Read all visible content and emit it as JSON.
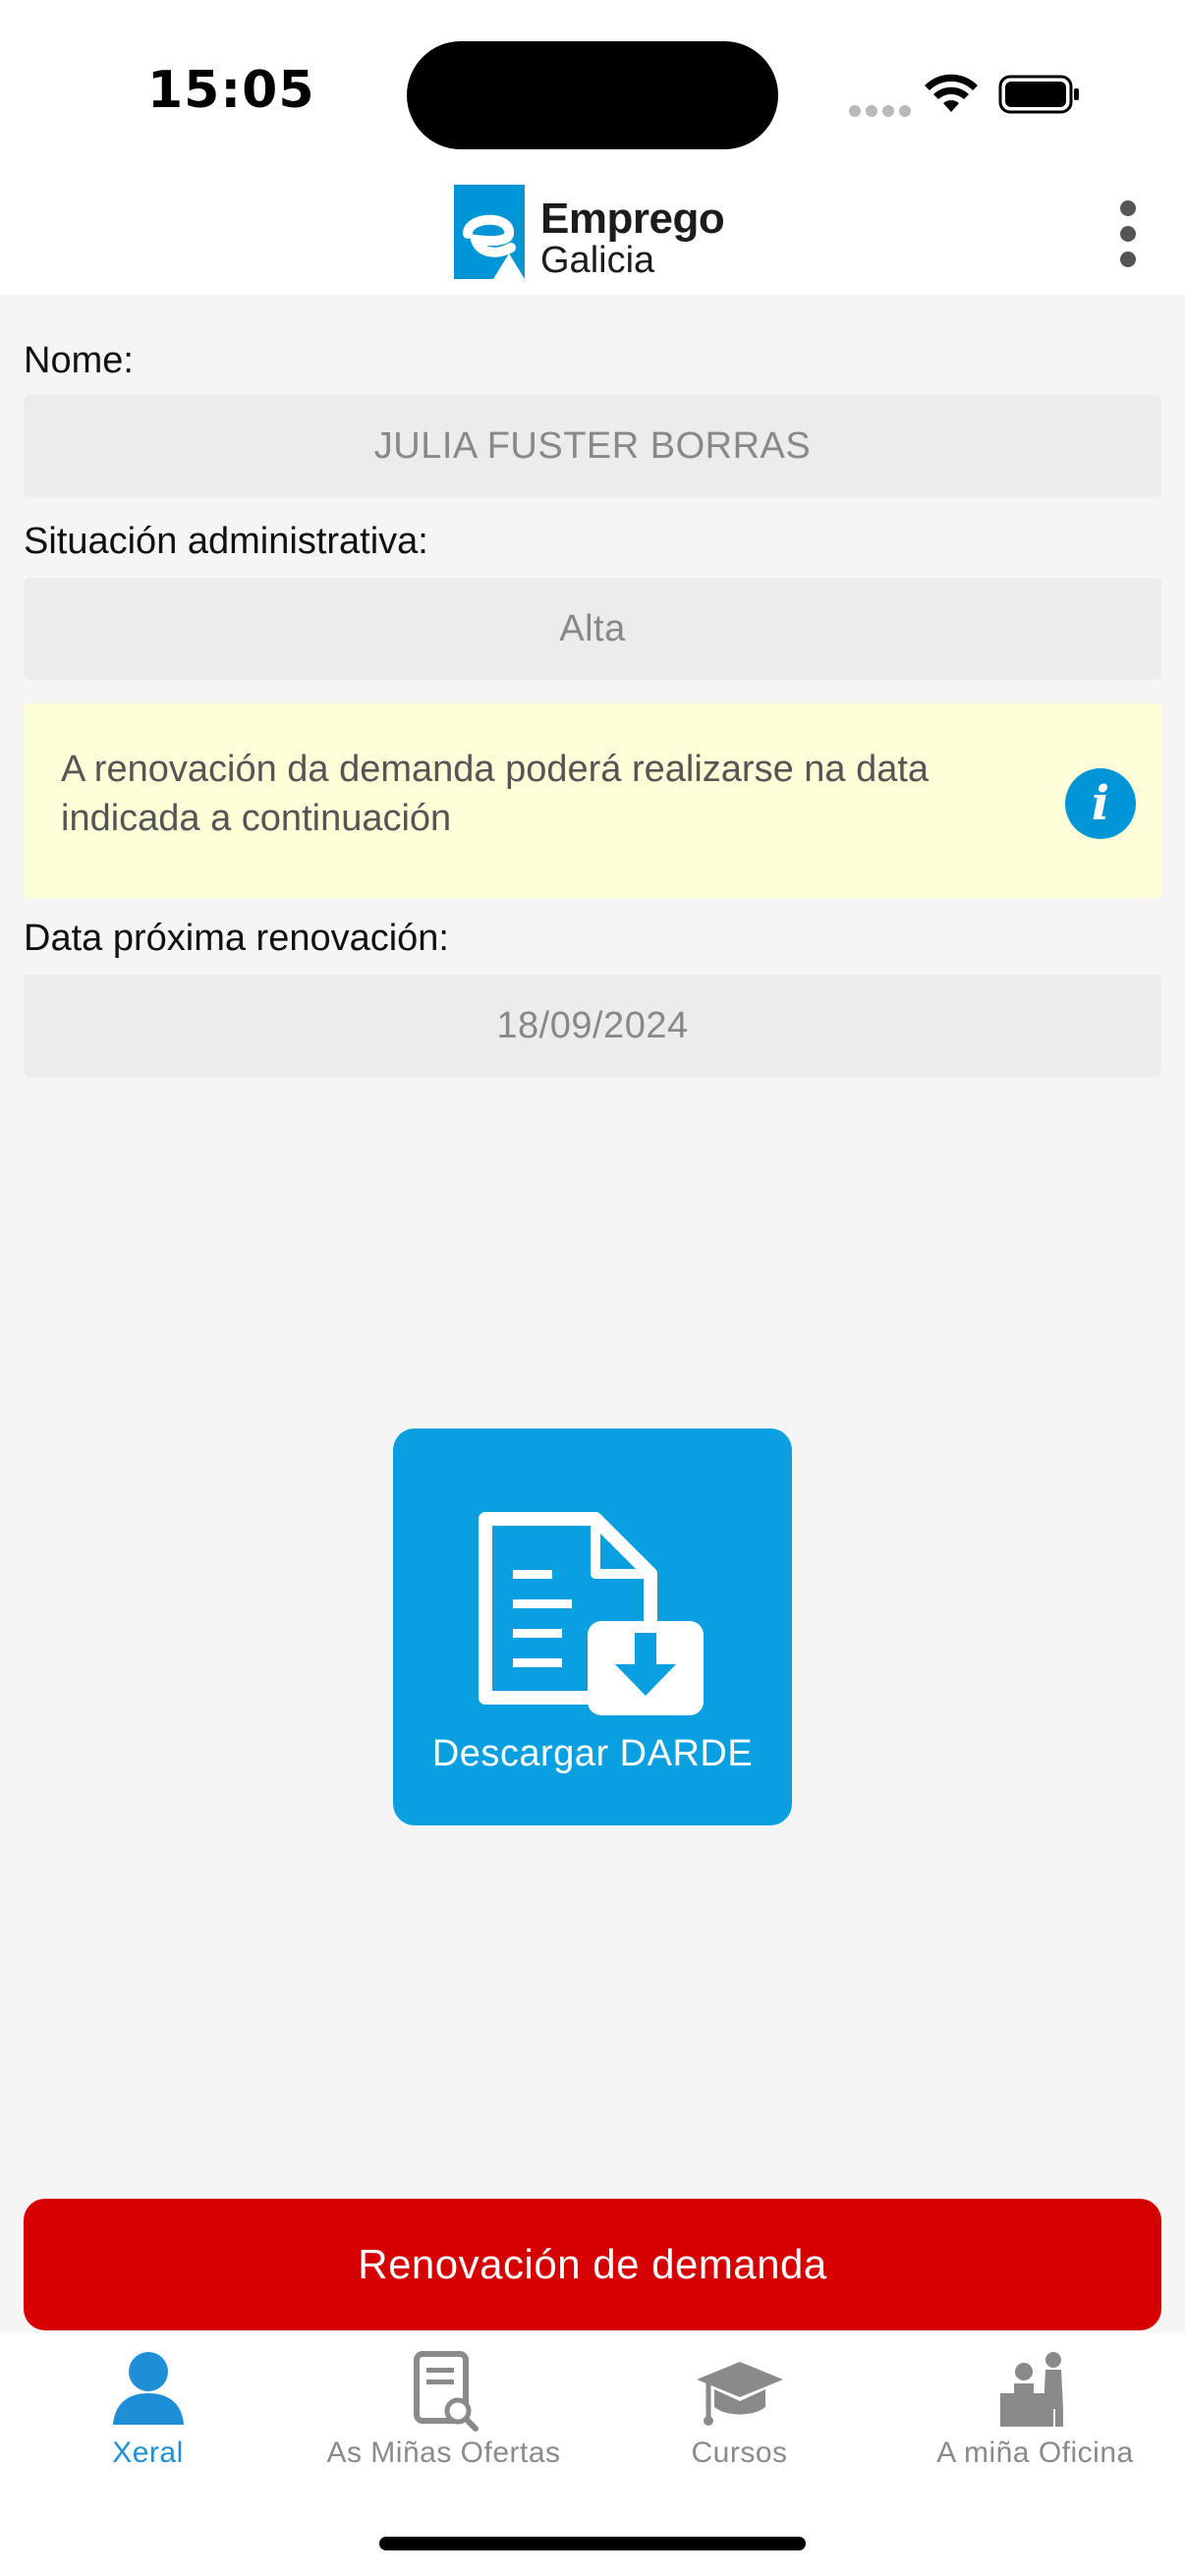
{
  "status_bar": {
    "time": "15:05"
  },
  "header": {
    "logo_line1": "Emprego",
    "logo_line2": "Galicia",
    "colors": {
      "logo_blue": "#0096d6"
    }
  },
  "form": {
    "name_label": "Nome:",
    "name_value": "JULIA FUSTER BORRAS",
    "status_label": "Situación administrativa:",
    "status_value": "Alta",
    "notice_text": "A renovación da demanda poderá realizarse na data indicada a continuación",
    "next_renewal_label": "Data próxima renovación:",
    "next_renewal_value": "18/09/2024"
  },
  "actions": {
    "download_label": "Descargar DARDE",
    "renew_label": "Renovación de demanda",
    "colors": {
      "download_bg": "#0aa0e0",
      "renew_bg": "#d60000"
    }
  },
  "tabs": [
    {
      "label": "Xeral",
      "icon": "user-icon",
      "active": true
    },
    {
      "label": "As Miñas Ofertas",
      "icon": "document-search-icon",
      "active": false
    },
    {
      "label": "Cursos",
      "icon": "graduation-cap-icon",
      "active": false
    },
    {
      "label": "A miña Oficina",
      "icon": "office-people-icon",
      "active": false
    }
  ]
}
